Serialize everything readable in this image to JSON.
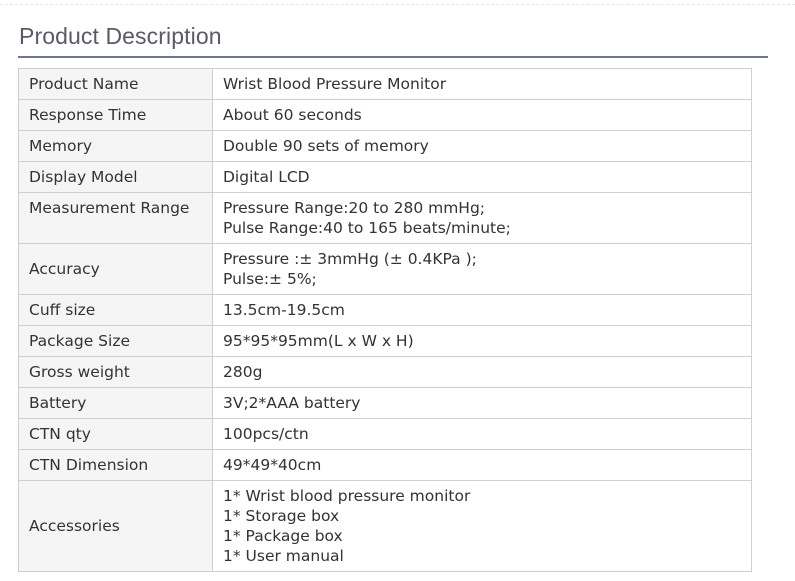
{
  "section": {
    "title": "Product Description"
  },
  "spec_table": {
    "rows": [
      {
        "label": "Product Name",
        "value": [
          "Wrist Blood Pressure Monitor"
        ]
      },
      {
        "label": "Response Time",
        "value": [
          "About 60 seconds"
        ]
      },
      {
        "label": "Memory",
        "value": [
          "Double 90 sets of memory"
        ]
      },
      {
        "label": "Display Model",
        "value": [
          "Digital LCD"
        ]
      },
      {
        "label": "Measurement Range",
        "value": [
          "Pressure Range:20 to 280 mmHg;",
          "Pulse Range:40 to 165 beats/minute;"
        ]
      },
      {
        "label": "Accuracy",
        "value": [
          "Pressure :± 3mmHg (± 0.4KPa );",
          "Pulse:± 5%;"
        ]
      },
      {
        "label": "Cuff size",
        "value": [
          "13.5cm-19.5cm"
        ]
      },
      {
        "label": "Package Size",
        "value": [
          "95*95*95mm(L x W x H)"
        ]
      },
      {
        "label": "Gross weight",
        "value": [
          "280g"
        ]
      },
      {
        "label": "Battery",
        "value": [
          "3V;2*AAA battery"
        ]
      },
      {
        "label": "CTN qty",
        "value": [
          "100pcs/ctn"
        ]
      },
      {
        "label": "CTN Dimension",
        "value": [
          "49*49*40cm"
        ]
      },
      {
        "label": "Accessories",
        "value": [
          "1* Wrist blood pressure monitor",
          "1* Storage box",
          "1* Package box",
          "1* User manual"
        ]
      }
    ]
  }
}
